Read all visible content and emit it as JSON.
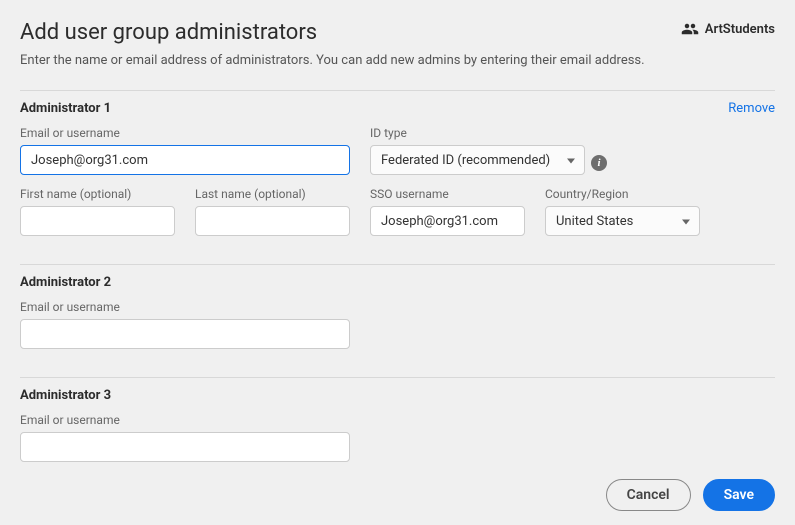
{
  "header": {
    "title": "Add user group administrators",
    "group_name": "ArtStudents",
    "subtitle": "Enter the name or email address of administrators. You can add new admins by entering their email address."
  },
  "admin1": {
    "section_title": "Administrator 1",
    "remove_label": "Remove",
    "email_label": "Email or username",
    "email_value": "Joseph@org31.com",
    "id_type_label": "ID type",
    "id_type_value": "Federated ID (recommended)",
    "first_name_label": "First name (optional)",
    "first_name_value": "",
    "last_name_label": "Last name (optional)",
    "last_name_value": "",
    "sso_label": "SSO username",
    "sso_value": "Joseph@org31.com",
    "country_label": "Country/Region",
    "country_value": "United States"
  },
  "admin2": {
    "section_title": "Administrator 2",
    "email_label": "Email or username",
    "email_value": ""
  },
  "admin3": {
    "section_title": "Administrator 3",
    "email_label": "Email or username",
    "email_value": ""
  },
  "footer": {
    "cancel_label": "Cancel",
    "save_label": "Save"
  }
}
